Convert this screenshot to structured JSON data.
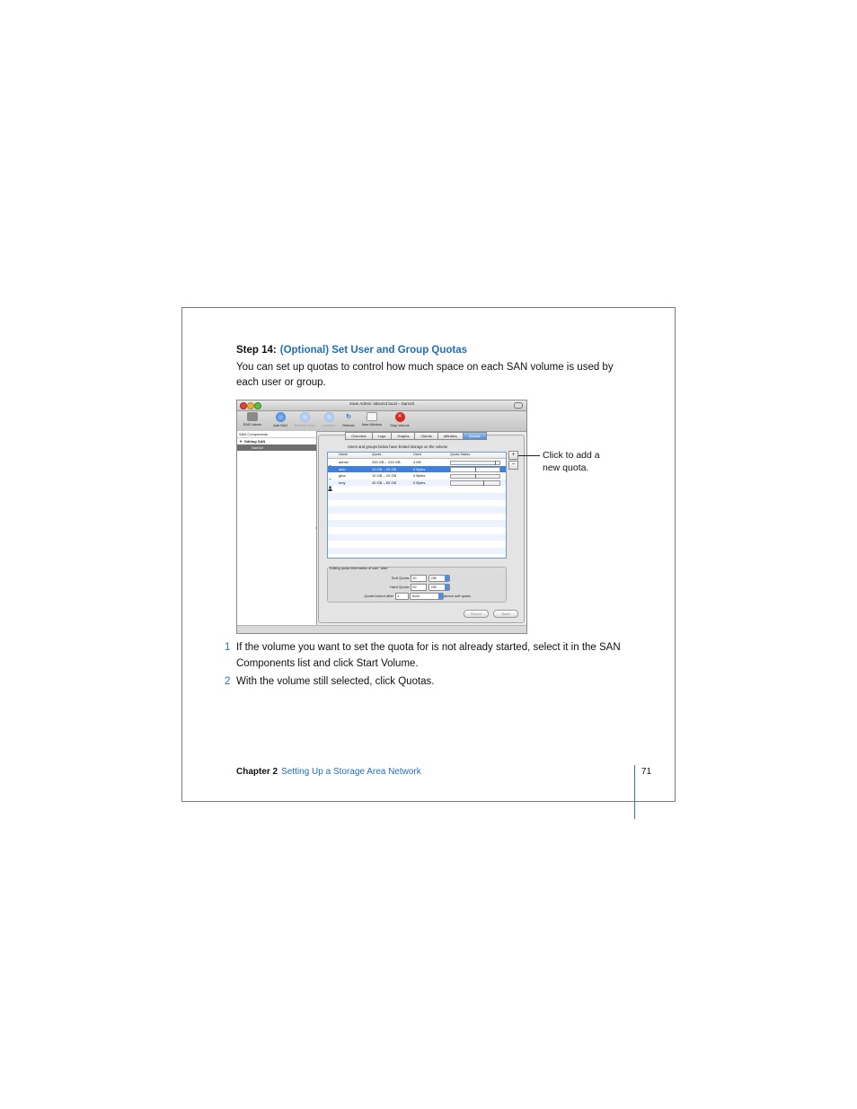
{
  "step": {
    "label": "Step 14:",
    "title": "(Optional) Set User and Group Quotas"
  },
  "intro": "You can set up quotas to control how much space on each SAN volume is used by each user or group.",
  "window": {
    "title": "Xsan Admin: labs413.local – SanVol",
    "toolbar": [
      "RAID Admin",
      "Add SAN",
      "Remove SAN",
      "Connect",
      "Refresh",
      "New Window",
      "Stop Volume"
    ],
    "sidebar": {
      "header": "SAN Components",
      "group": "Editing SAN",
      "selected": "SanVol"
    },
    "tabs": [
      "Overview",
      "Logs",
      "Graphs",
      "Clients",
      "Affinities",
      "Quotas"
    ],
    "active_tab": "Quotas",
    "quota_label": "Users and groups below have limited storage on the volume",
    "columns": [
      "Name",
      "Quota",
      "Used",
      "Quota Status"
    ],
    "rows": [
      {
        "name": "admin",
        "quota": "200 GB – 220 GB",
        "used": "4 KB",
        "fill": 0.0,
        "mark": 0.91
      },
      {
        "name": "aldo",
        "quota": "10 GB – 20 GB",
        "used": "0 Bytes",
        "fill": 0.0,
        "mark": 0.5
      },
      {
        "name": "gina",
        "quota": "10 GB – 20 GB",
        "used": "0 Bytes",
        "fill": 0.0,
        "mark": 0.5
      },
      {
        "name": "tony",
        "quota": "40 GB – 60 GB",
        "used": "0 Bytes",
        "fill": 0.0,
        "mark": 0.67
      }
    ],
    "selected_row": 1,
    "edit_title": "Editing quota information of user \"aldo\"",
    "soft_quota": {
      "label": "Soft Quota:",
      "value": "10",
      "unit": "GB"
    },
    "hard_quota": {
      "label": "Hard Quota:",
      "value": "20",
      "unit": "GB"
    },
    "locked": {
      "label": "Quota locked after",
      "value": "1",
      "unit": "hour",
      "suffix": "above soft quota"
    },
    "buttons": {
      "revert": "Revert",
      "save": "Save"
    },
    "plus": "+",
    "minus": "−"
  },
  "callout": {
    "line1": "Click to add a",
    "line2": "new quota."
  },
  "steps": [
    {
      "num": "1",
      "text": "If the volume you want to set the quota for is not already started, select it in the SAN Components list and click Start Volume."
    },
    {
      "num": "2",
      "text": "With the volume still selected, click Quotas."
    }
  ],
  "footer": {
    "chapter": "Chapter 2",
    "title": "Setting Up a Storage Area Network",
    "page": "71"
  }
}
